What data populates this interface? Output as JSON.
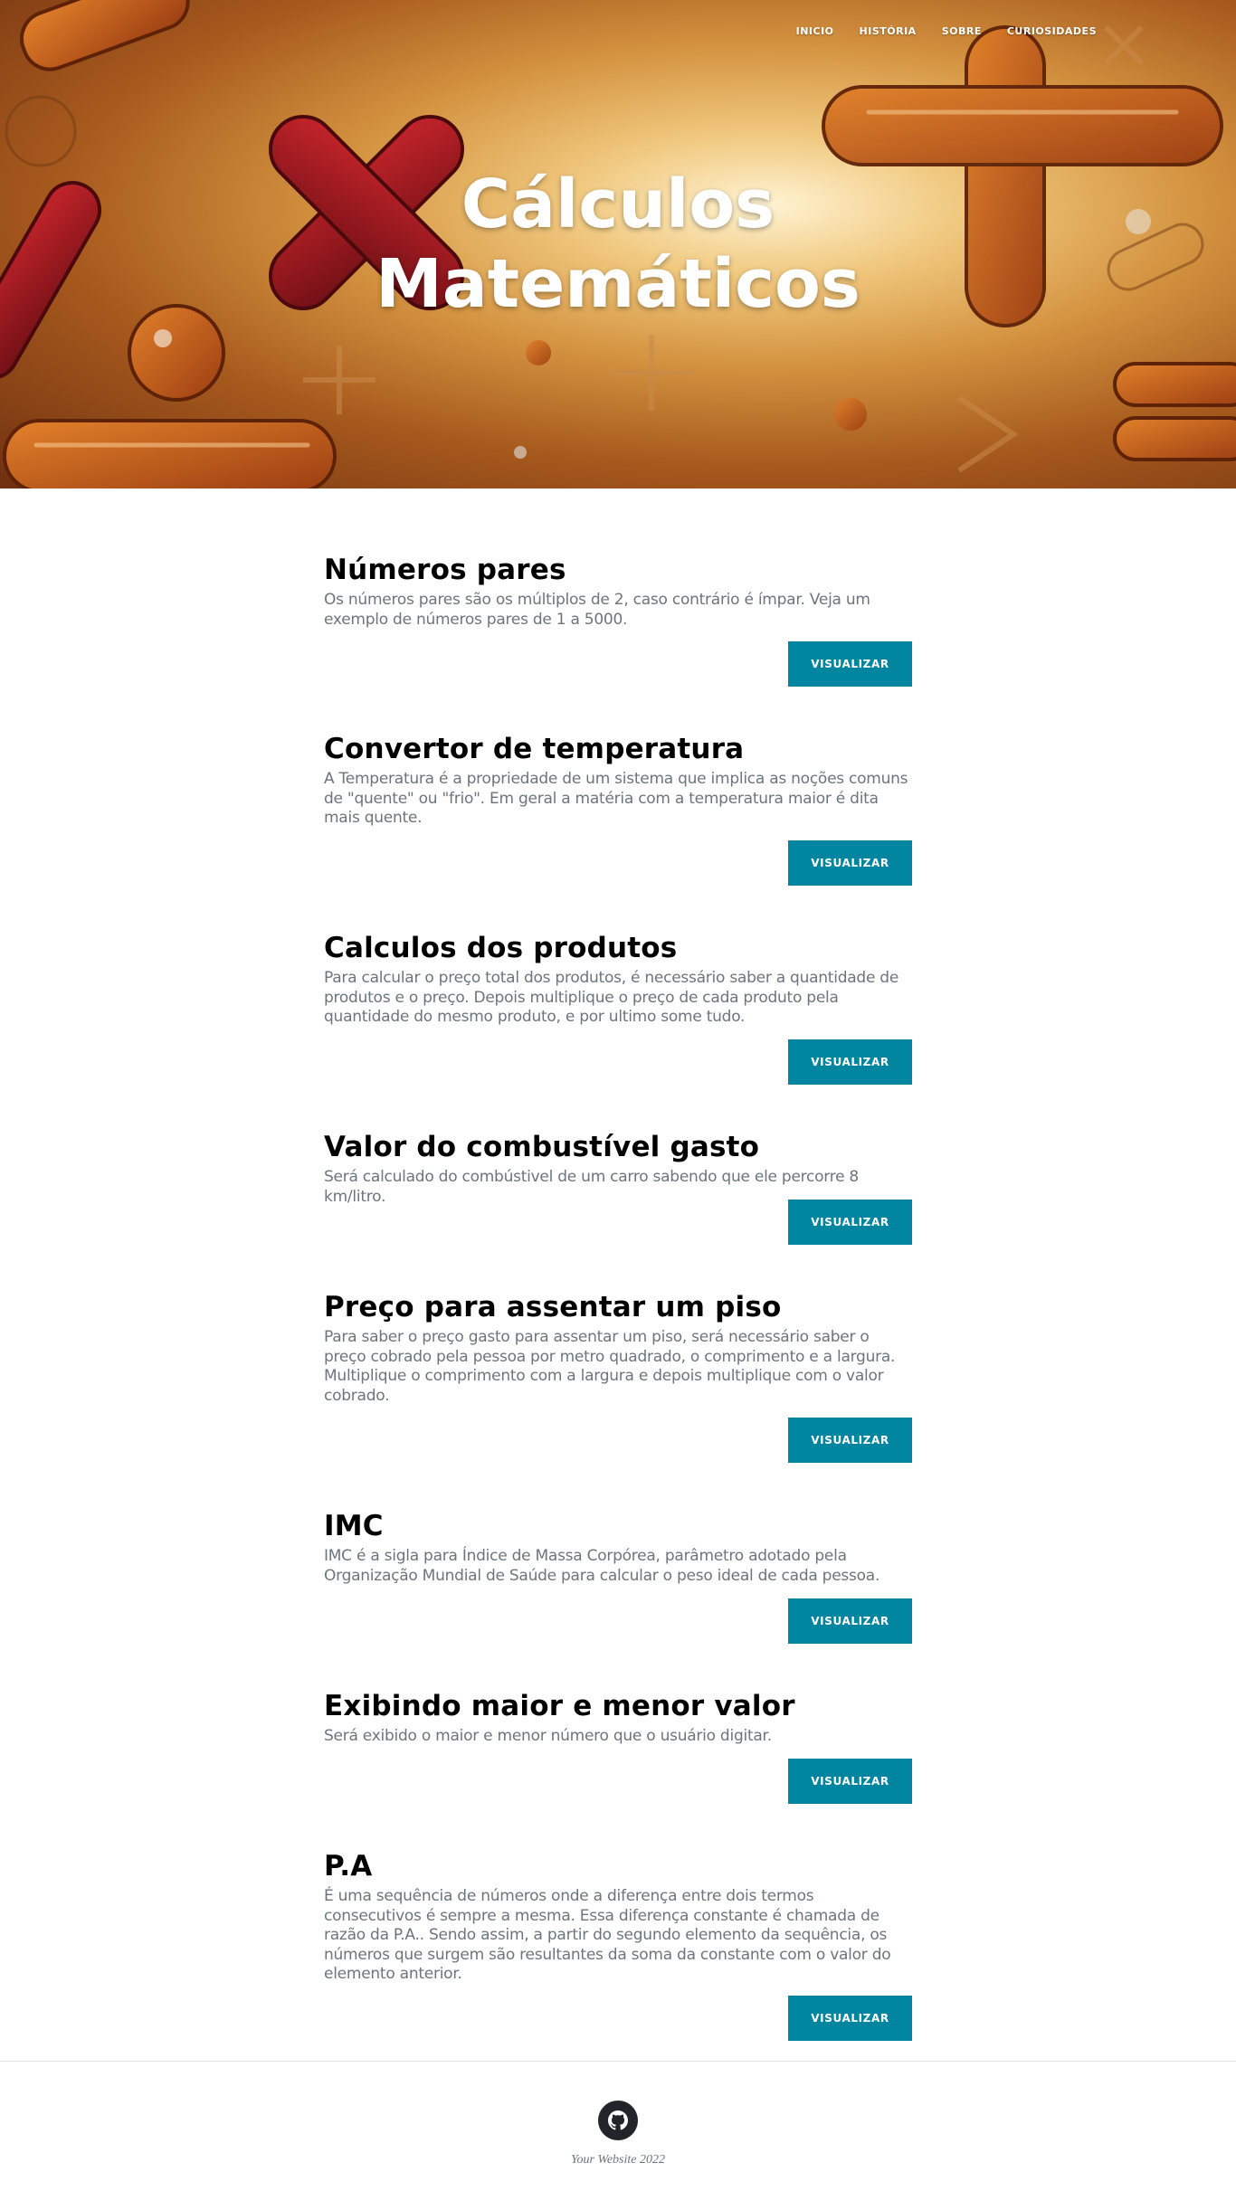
{
  "nav": {
    "items": [
      "INICIO",
      "HISTÓRIA",
      "SOBRE",
      "CURIOSIDADES"
    ]
  },
  "hero": {
    "title_line1": "Cálculos",
    "title_line2": "Matemáticos"
  },
  "posts": [
    {
      "title": "Números pares",
      "text": "Os números pares são os múltiplos de 2, caso contrário é ímpar. Veja um exemplo de números pares de 1 a 5000.",
      "button": "VISUALIZAR"
    },
    {
      "title": "Convertor de temperatura",
      "text": "A Temperatura é a propriedade de um sistema que implica as noções comuns de \"quente\" ou \"frio\". Em geral a matéria com a temperatura maior é dita mais quente.",
      "button": "VISUALIZAR"
    },
    {
      "title": "Calculos dos produtos",
      "text": "Para calcular o preço total dos produtos, é necessário saber a quantidade de produtos e o preço. Depois multiplique o preço de cada produto pela quantidade do mesmo produto, e por ultimo some tudo.",
      "button": "VISUALIZAR"
    },
    {
      "title": "Valor do combustível gasto",
      "text": "Será calculado do combústivel de um carro sabendo que ele percorre 8 km/litro.",
      "button": "VISUALIZAR"
    },
    {
      "title": "Preço para assentar um piso",
      "text": "Para saber o preço gasto para assentar um piso, será necessário saber o preço cobrado pela pessoa por metro quadrado, o comprimento e a largura. Multiplique o comprimento com a largura e depois multiplique com o valor cobrado.",
      "button": "VISUALIZAR"
    },
    {
      "title": "IMC",
      "text": "IMC é a sigla para Índice de Massa Corpórea, parâmetro adotado pela Organização Mundial de Saúde para calcular o peso ideal de cada pessoa.",
      "button": "VISUALIZAR"
    },
    {
      "title": "Exibindo maior e menor valor",
      "text": "Será exibido o maior e menor número que o usuário digitar.",
      "button": "VISUALIZAR"
    },
    {
      "title": "P.A",
      "text": "É uma sequência de números onde a diferença entre dois termos consecutivos é sempre a mesma. Essa diferença constante é chamada de razão da P.A.. Sendo assim, a partir do segundo elemento da sequência, os números que surgem são resultantes da soma da constante com o valor do elemento anterior.",
      "button": "VISUALIZAR"
    }
  ],
  "footer": {
    "icon": "github-icon",
    "copyright": "Your Website 2022"
  },
  "colors": {
    "button": "#0085a1",
    "footer_icon_bg": "#212529"
  }
}
